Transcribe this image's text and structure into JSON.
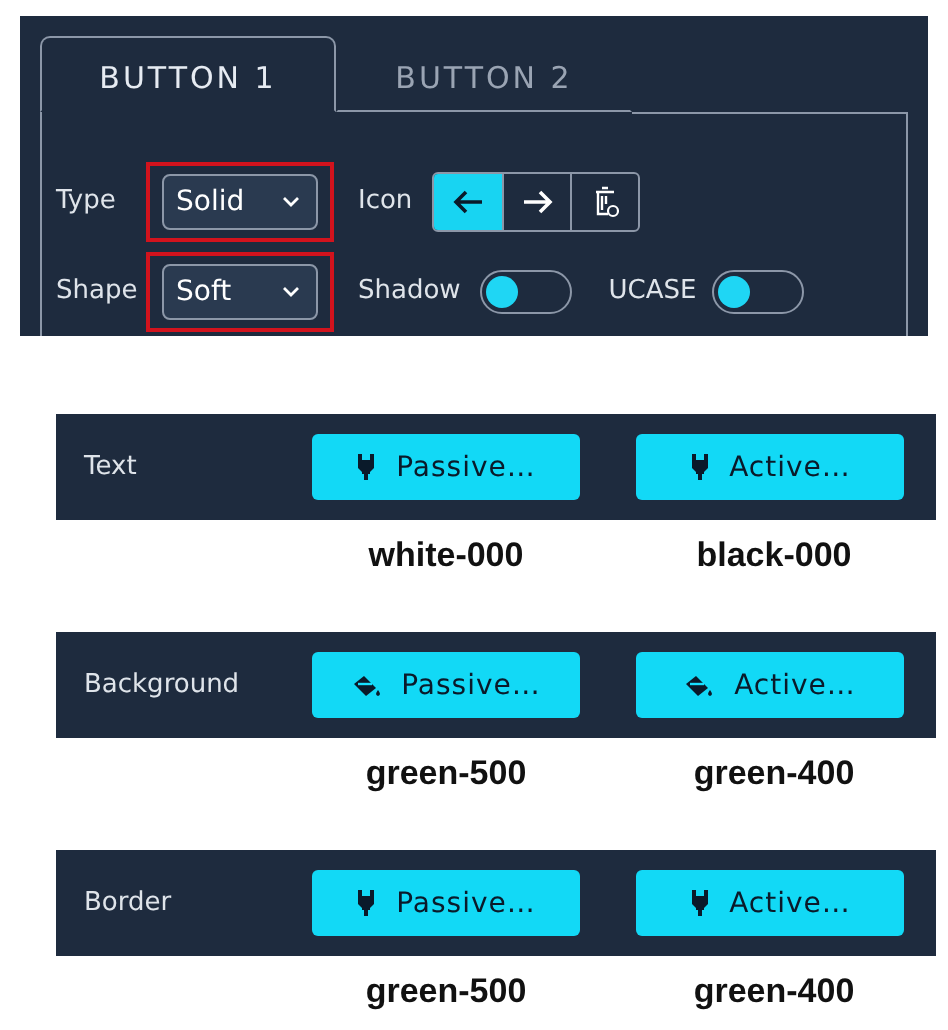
{
  "tabs": [
    {
      "label": "BUTTON 1",
      "selected": true
    },
    {
      "label": "BUTTON 2",
      "selected": false
    }
  ],
  "selects": [
    {
      "label": "Type",
      "value": "Solid",
      "highlighted": true
    },
    {
      "label": "Shape",
      "value": "Soft",
      "highlighted": true
    }
  ],
  "icon_group": {
    "label": "Icon",
    "options": [
      {
        "kind": "arrow-left",
        "selected": true
      },
      {
        "kind": "arrow-right",
        "selected": false
      },
      {
        "kind": "trash",
        "selected": false
      }
    ]
  },
  "toggles": [
    {
      "label": "Shadow",
      "on": false
    },
    {
      "label": "UCASE",
      "on": false
    }
  ],
  "swatches": [
    {
      "label": "Text",
      "buttons": [
        {
          "kind": "marker",
          "label": "Passive…",
          "caption": "white-000"
        },
        {
          "kind": "marker",
          "label": "Active…",
          "caption": "black-000"
        }
      ]
    },
    {
      "label": "Background",
      "buttons": [
        {
          "kind": "bucket",
          "label": "Passive…",
          "caption": "green-500"
        },
        {
          "kind": "bucket",
          "label": "Active…",
          "caption": "green-400"
        }
      ]
    },
    {
      "label": "Border",
      "buttons": [
        {
          "kind": "marker",
          "label": "Passive…",
          "caption": "green-500"
        },
        {
          "kind": "marker",
          "label": "Active…",
          "caption": "green-400"
        }
      ]
    }
  ]
}
